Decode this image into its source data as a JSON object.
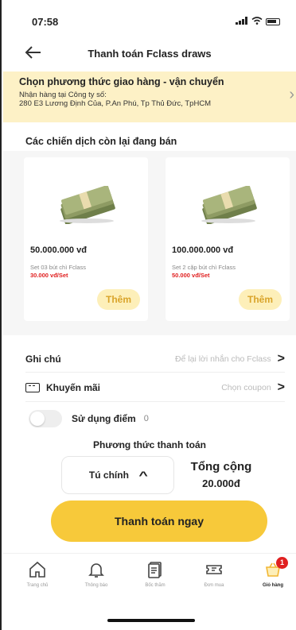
{
  "status_bar": {
    "time": "07:58",
    "signal": "∷",
    "wifi": "◠"
  },
  "header": {
    "title": "Thanh toán Fclass draws"
  },
  "delivery": {
    "title": "Chọn phương thức giao hàng - vận chuyển",
    "line1": "Nhận hàng tại Công ty số:",
    "line2": "280 E3 Lương Định Của, P.An Phú, Tp Thủ Đức, TpHCM",
    "bg_color": "#fdf1c6"
  },
  "campaigns": {
    "title": "Các chiến dịch còn lại đang bán",
    "items": [
      {
        "price": "50.000.000 vđ",
        "set_desc": "Set 03 bút chì Fclass",
        "set_price": "30.000 vđ/Set",
        "add_label": "Thêm",
        "image": "money-stack"
      },
      {
        "price": "100.000.000 vđ",
        "set_desc": "Set 2 cặp bút chì Fclass",
        "set_price": "50.000 vđ/Set",
        "add_label": "Thêm",
        "image": "money-stack"
      }
    ]
  },
  "note": {
    "label": "Ghi chú",
    "placeholder": "Để lại lời nhắn cho Fclass"
  },
  "promo": {
    "label": "Khuyến mãi",
    "placeholder": "Chọn coupon"
  },
  "points": {
    "label": "Sử dụng điểm",
    "value": "0",
    "enabled": false
  },
  "payment": {
    "title": "Phương thức thanh toán",
    "selected": "Tú chính",
    "total_label": "Tổng cộng",
    "total_value": "20.000đ",
    "pay_button": "Thanh toán ngay",
    "accent": "#f7c93a"
  },
  "nav": {
    "items": [
      {
        "label": "Trang chủ",
        "icon": "home-icon"
      },
      {
        "label": "Thông báo",
        "icon": "bell-icon"
      },
      {
        "label": "Bốc thăm",
        "icon": "draw-icon"
      },
      {
        "label": "Đơn mua",
        "icon": "ticket-icon"
      },
      {
        "label": "Giỏ hàng",
        "icon": "cart-icon",
        "badge": "1",
        "active": true
      }
    ]
  }
}
